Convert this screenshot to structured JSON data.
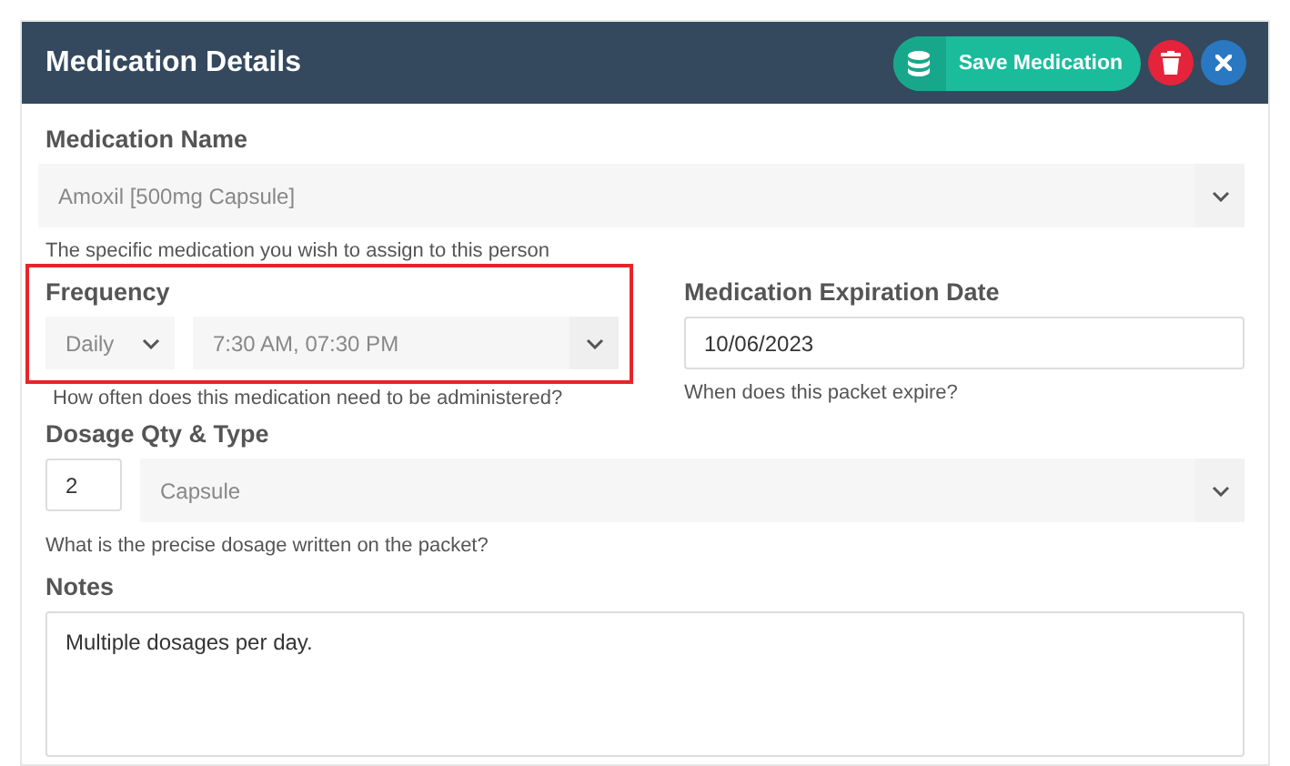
{
  "panel": {
    "title": "Medication Details",
    "actions": [
      {
        "kind": "save",
        "label": "Save Medication"
      },
      {
        "kind": "delete"
      },
      {
        "kind": "close"
      }
    ]
  },
  "rows": [
    {
      "groups": [
        {
          "label": "Medication Name",
          "highlighted": false,
          "controls": [
            {
              "kind": "select",
              "value": "Amoxil [500mg Capsule]"
            }
          ],
          "hint": "The specific medication you wish to assign to this person"
        }
      ]
    },
    {
      "groups": [
        {
          "label": "Frequency",
          "highlighted": true,
          "controls": [
            {
              "kind": "select-small",
              "value": "Daily"
            },
            {
              "kind": "select",
              "value": "7:30 AM, 07:30 PM"
            }
          ],
          "hint": "How often does this medication need to be administered?"
        },
        {
          "label": "Medication Expiration Date",
          "highlighted": false,
          "controls": [
            {
              "kind": "input",
              "value": "10/06/2023"
            }
          ],
          "hint": "When does this packet expire?"
        }
      ]
    },
    {
      "groups": [
        {
          "label": "Dosage Qty & Type",
          "highlighted": false,
          "controls": [
            {
              "kind": "input-small",
              "value": "2"
            },
            {
              "kind": "select",
              "value": "Capsule"
            }
          ],
          "hint": "What is the precise dosage written on the packet?"
        }
      ]
    },
    {
      "groups": [
        {
          "label": "Notes",
          "highlighted": false,
          "controls": [
            {
              "kind": "textarea",
              "value": "Multiple dosages per day."
            }
          ]
        }
      ]
    }
  ]
}
